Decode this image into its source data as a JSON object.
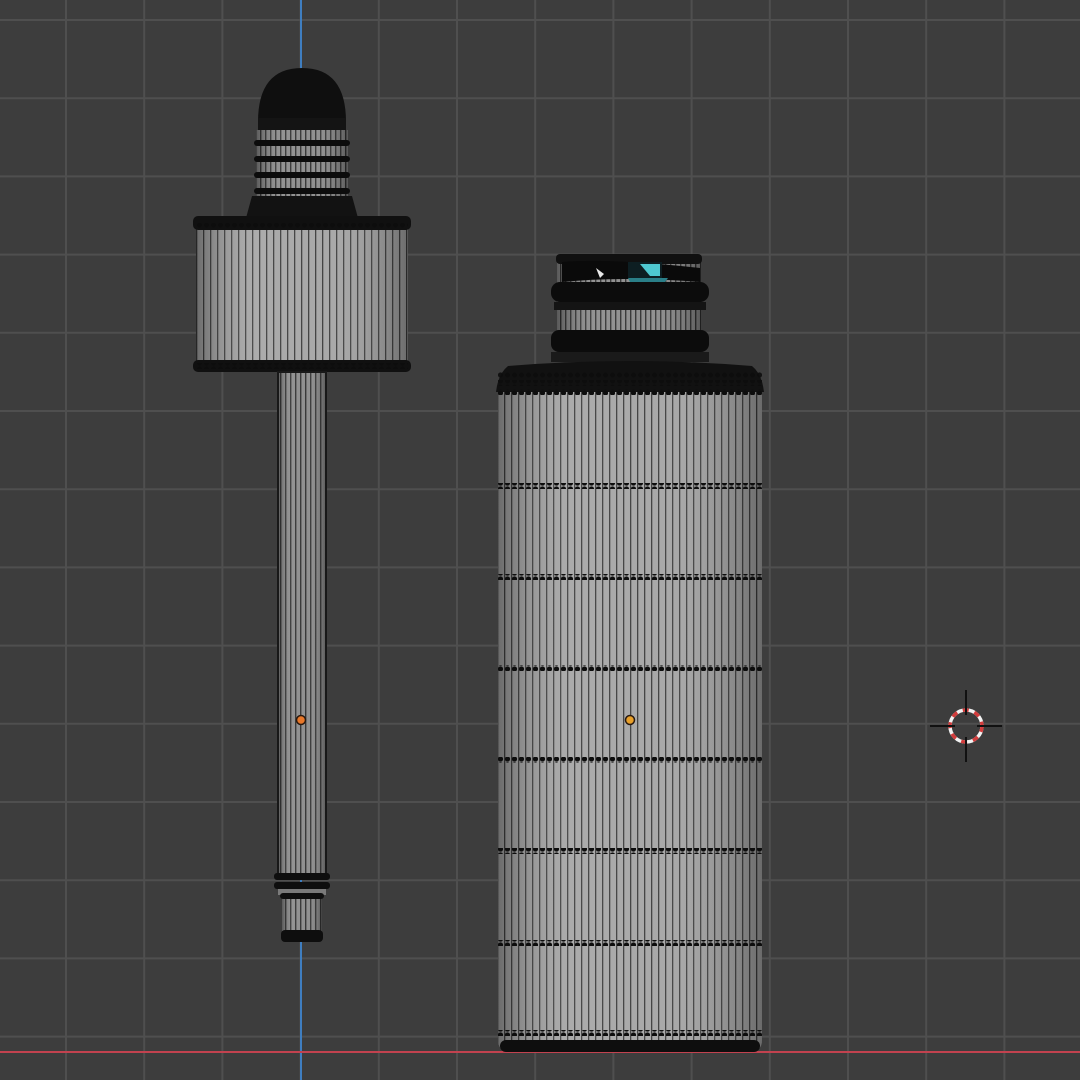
{
  "viewport": {
    "view": "front-orthographic",
    "shading": "wireframe-over-solid",
    "background_color": "#3d3d3d",
    "grid_color": "#4f4f4f",
    "axis_x_color": "#c2424f",
    "axis_z_color": "#3f7ec0"
  },
  "scene": {
    "objects": [
      {
        "name": "dropper",
        "parts": [
          "rubber-bulb",
          "collar-rings",
          "cap",
          "glass-pipette",
          "pipette-tip"
        ],
        "selected": false,
        "origin_color": "#e8782a"
      },
      {
        "name": "bottle",
        "parts": [
          "thread-neck",
          "shoulder",
          "body"
        ],
        "selected": false,
        "origin_color": "#e8a02a"
      }
    ],
    "mesh_color": "#9a9a9a",
    "edge_color": "#111111",
    "highlight_color": "#4ec8d0",
    "cursor_colors": [
      "#d23c3c",
      "#f2f2f2"
    ]
  }
}
